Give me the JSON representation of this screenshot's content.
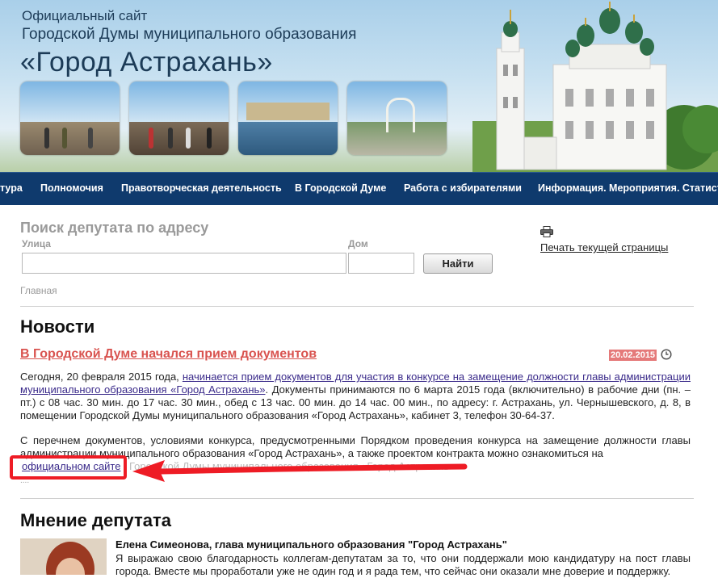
{
  "header": {
    "line1": "Официальный сайт",
    "line2": "Городской Думы муниципального образования",
    "line3": "«Город Астрахань»"
  },
  "nav": {
    "items": [
      {
        "label": "тура"
      },
      {
        "label": "Полномочия"
      },
      {
        "label": "Правотворческая деятельность"
      },
      {
        "label": "В Городской Думе"
      },
      {
        "label": "Работа с избирателями"
      },
      {
        "label": "Информация. Мероприятия. Статист"
      }
    ]
  },
  "search": {
    "title": "Поиск депутата по адресу",
    "street_label": "Улица",
    "house_label": "Дом",
    "street_value": "",
    "house_value": "",
    "button": "Найти"
  },
  "print": {
    "label": "Печать текущей страницы"
  },
  "breadcrumb": "Главная",
  "news": {
    "heading": "Новости",
    "title": "В Городской Думе начался прием документов",
    "date": "20.02.2015",
    "p1_pre": "Сегодня, 20 февраля 2015 года, ",
    "p1_link": "начинается прием документов для участия в конкурсе на замещение должности главы администрации муниципального образования «Город Астрахань»",
    "p1_post": ". Документы принимаются по 6 марта 2015 года (включительно) в рабочие дни (пн. – пт.) с 08 час. 30 мин. до 17 час. 30 мин., обед с 13 час. 00 мин. до 14 час. 00 мин., по адресу: г. Астрахань, ул. Чернышевского, д. 8, в помещении Городской Думы муниципального образования «Город Астрахань», кабинет 3, телефон 30-64-37.",
    "p2": "С перечнем документов, условиями конкурса, предусмотренными Порядком проведения конкурса на замещение должности главы администрации муниципального образования «Город Астрахань», а также проектом контракта можно ознакомиться на",
    "p2_link": "официальном сайте",
    "p2_tail": "Городской Думы муниципального образования «Город Астрахань»",
    "more": "...."
  },
  "opinion": {
    "heading": "Мнение депутата",
    "name": "Елена Симеонова, глава муниципального образования \"Город Астрахань\"",
    "text": "Я выражаю свою благодарность коллегам-депутатам за то, что они поддержали мою кандидатуру на пост главы города. Вместе мы проработали уже не один год и я рада тем, что сейчас они оказали мне доверие и поддержку."
  },
  "colors": {
    "nav_bg": "#0f3a6d",
    "news_title": "#d9534f",
    "date_bg": "#e57a7a",
    "annotation": "#ee1c25"
  },
  "icons": {
    "print": "printer-icon",
    "date": "clock-icon",
    "annotation_arrow": "arrow-left-icon"
  }
}
